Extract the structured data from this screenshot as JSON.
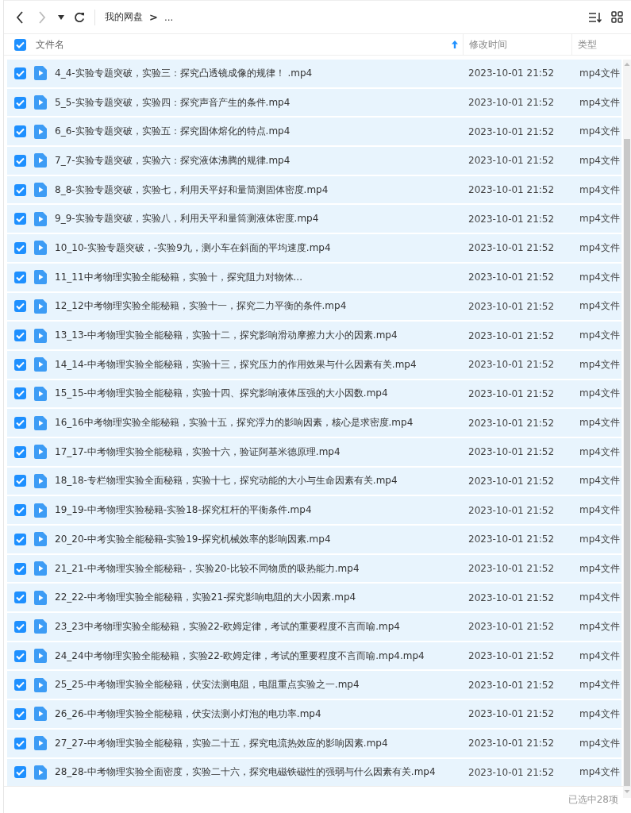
{
  "toolbar": {
    "back_disabled": false,
    "forward_disabled": true,
    "breadcrumb": [
      "我的网盘"
    ],
    "separator": ">",
    "ellipsis": "..."
  },
  "header": {
    "select_all_checked": true,
    "columns": [
      {
        "label": "文件名",
        "sorted": true
      },
      {
        "label": "修改时间",
        "sorted": false
      },
      {
        "label": "类型",
        "sorted": false
      }
    ]
  },
  "rows": [
    {
      "name": "4_4-实验专题突破，实验三：探究凸透镜成像的规律！ .mp4",
      "modified": "2023-10-01 21:52",
      "type": "mp4文件",
      "checked": true
    },
    {
      "name": "5_5-实验专题突破，实验四：探究声音产生的条件.mp4",
      "modified": "2023-10-01 21:52",
      "type": "mp4文件",
      "checked": true
    },
    {
      "name": "6_6-实验专题突破，实验五：探究固体熔化的特点.mp4",
      "modified": "2023-10-01 21:52",
      "type": "mp4文件",
      "checked": true
    },
    {
      "name": "7_7-实验专题突破，实验六：探究液体沸腾的规律.mp4",
      "modified": "2023-10-01 21:52",
      "type": "mp4文件",
      "checked": true
    },
    {
      "name": "8_8-实验专题突破，实验七，利用天平好和量筒测固体密度.mp4",
      "modified": "2023-10-01 21:52",
      "type": "mp4文件",
      "checked": true
    },
    {
      "name": "9_9-实验专题突破，实验八，利用天平和量筒测液体密度.mp4",
      "modified": "2023-10-01 21:52",
      "type": "mp4文件",
      "checked": true
    },
    {
      "name": "10_10-实验专题突破，-实验9九，测小车在斜面的平均速度.mp4",
      "modified": "2023-10-01 21:52",
      "type": "mp4文件",
      "checked": true
    },
    {
      "name": "11_11中考物理实验全能秘籍，实验十，探究阻力对物体...",
      "modified": "2023-10-01 21:52",
      "type": "mp4文件",
      "checked": true
    },
    {
      "name": "12_12中考物理实验全能秘籍，实验十一，探究二力平衡的条件.mp4",
      "modified": "2023-10-01 21:52",
      "type": "mp4文件",
      "checked": true
    },
    {
      "name": "13_13-中考物理实验全能秘籍，实验十二，探究影响滑动摩擦力大小的因素.mp4",
      "modified": "2023-10-01 21:52",
      "type": "mp4文件",
      "checked": true
    },
    {
      "name": "14_14-中考物理实验全能秘籍，实验十三，探究压力的作用效果与什么因素有关.mp4",
      "modified": "2023-10-01 21:52",
      "type": "mp4文件",
      "checked": true
    },
    {
      "name": "15_15-中考物理实验全能秘籍，实验十四、探究影响液体压强的大小因数.mp4",
      "modified": "2023-10-01 21:52",
      "type": "mp4文件",
      "checked": true
    },
    {
      "name": "16_16中考物理实验全能秘籍，实验十五，探究浮力的影响因素，核心是求密度.mp4",
      "modified": "2023-10-01 21:52",
      "type": "mp4文件",
      "checked": true
    },
    {
      "name": "17_17-中考物理实验全能秘籍，实验十六，验证阿基米德原理.mp4",
      "modified": "2023-10-01 21:52",
      "type": "mp4文件",
      "checked": true
    },
    {
      "name": "18_18-专栏物理实验全面秘籍，实验十七，探究动能的大小与生命因素有关.mp4",
      "modified": "2023-10-01 21:52",
      "type": "mp4文件",
      "checked": true
    },
    {
      "name": "19_19-中考物理实验秘籍-实验18-探究杠杆的平衡条件.mp4",
      "modified": "2023-10-01 21:52",
      "type": "mp4文件",
      "checked": true
    },
    {
      "name": "20_20-中考实验全能秘籍-实验19-探究机械效率的影响因素.mp4",
      "modified": "2023-10-01 21:52",
      "type": "mp4文件",
      "checked": true
    },
    {
      "name": "21_21-中考物理实验全能秘籍-，实验20-比较不同物质的吸热能力.mp4",
      "modified": "2023-10-01 21:52",
      "type": "mp4文件",
      "checked": true
    },
    {
      "name": "22_22-中考物理实验全能秘籍，实验21-探究影响电阻的大小因素.mp4",
      "modified": "2023-10-01 21:52",
      "type": "mp4文件",
      "checked": true
    },
    {
      "name": "23_23中考物理实验全能秘籍，实验22-欧姆定律，考试的重要程度不言而喻.mp4",
      "modified": "2023-10-01 21:52",
      "type": "mp4文件",
      "checked": true
    },
    {
      "name": "24_24中考物理实验全能秘籍，实验22-欧姆定律，考试的重要程度不言而喻.mp4.mp4",
      "modified": "2023-10-01 21:52",
      "type": "mp4文件",
      "checked": true
    },
    {
      "name": "25_25-中考物理实验全能秘籍，伏安法测电阻，电阻重点实验之一.mp4",
      "modified": "2023-10-01 21:52",
      "type": "mp4文件",
      "checked": true
    },
    {
      "name": "26_26-中考物理实验全能秘籍，伏安法测小灯泡的电功率.mp4",
      "modified": "2023-10-01 21:52",
      "type": "mp4文件",
      "checked": true
    },
    {
      "name": "27_27-中考物理实验全能秘籍，实验二十五，探究电流热效应的影响因素.mp4",
      "modified": "2023-10-01 21:52",
      "type": "mp4文件",
      "checked": true
    },
    {
      "name": "28_28-中考物理实验全面密度，实验二十六，探究电磁铁磁性的强弱与什么因素有关.mp4",
      "modified": "2023-10-01 21:52",
      "type": "mp4文件",
      "checked": true
    }
  ],
  "status_bar": {
    "selection": "已选中28项"
  }
}
